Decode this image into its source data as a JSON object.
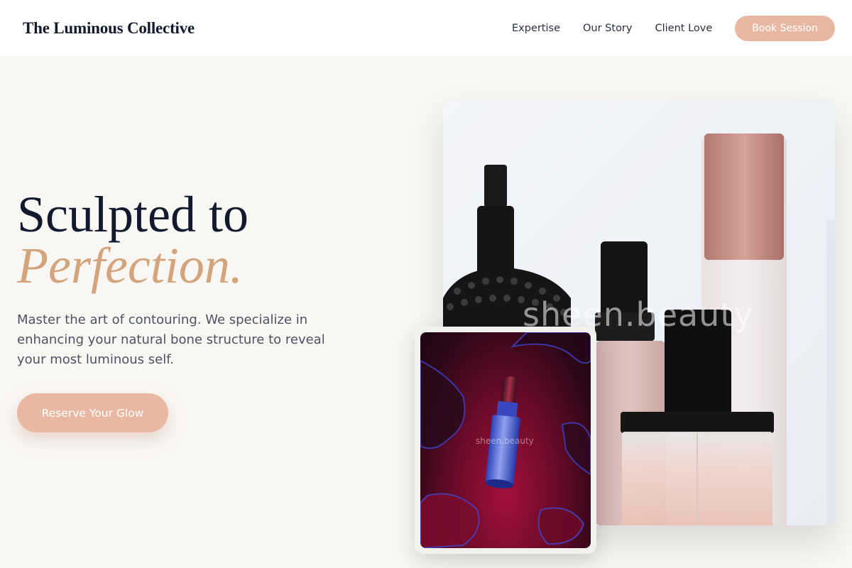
{
  "header": {
    "brand": "The Luminous Collective",
    "nav": [
      "Expertise",
      "Our Story",
      "Client Love"
    ],
    "cta_label": "Book Session"
  },
  "hero": {
    "title_line1": "Sculpted to",
    "title_line2": "Perfection.",
    "description": "Master the art of contouring. We specialize in enhancing your natural bone structure to reveal your most luminous self.",
    "cta_label": "Reserve Your Glow"
  },
  "images": {
    "main_watermark": "sheen.beauty",
    "small_watermark": "sheen.beauty"
  },
  "colors": {
    "accent": "#e8b8a3",
    "gold": "#d4a47c",
    "ink": "#141a2e",
    "background": "#f9f7f4"
  }
}
